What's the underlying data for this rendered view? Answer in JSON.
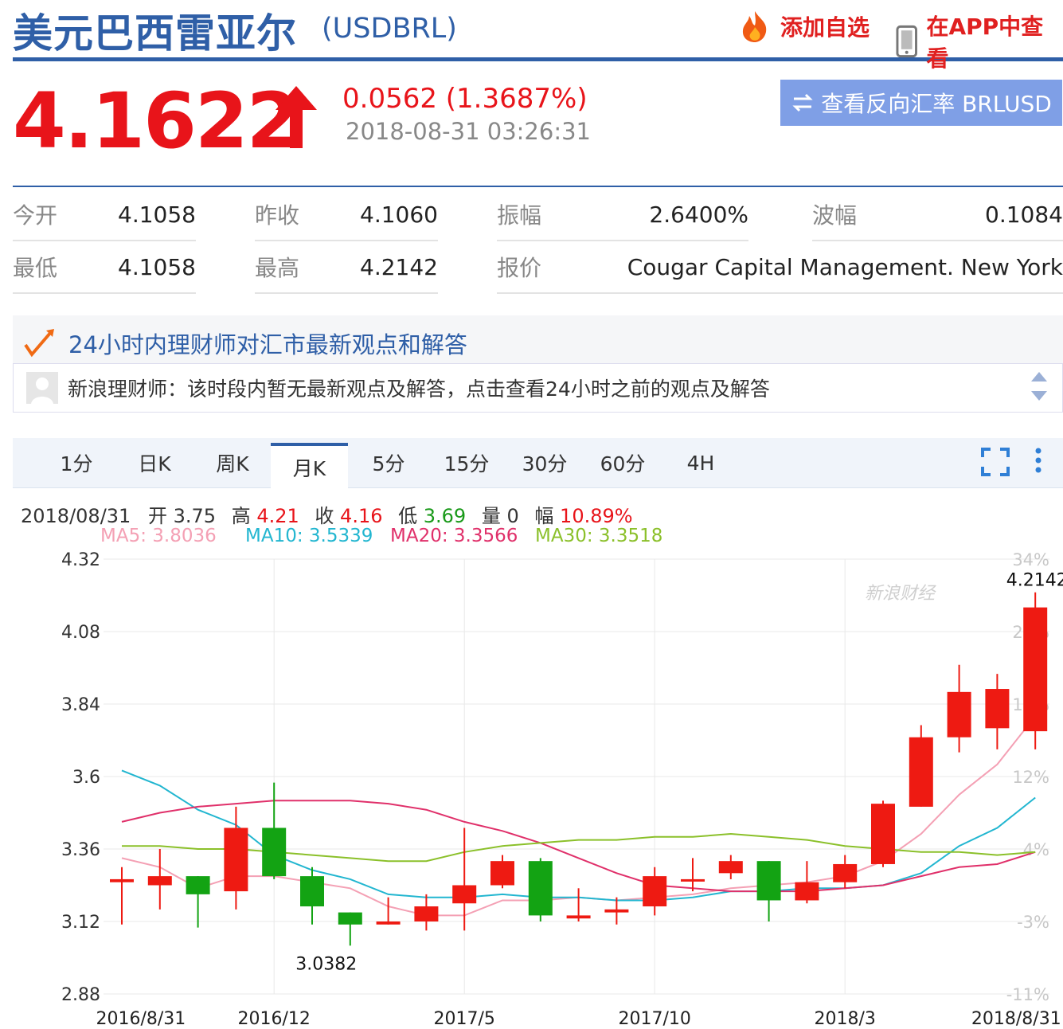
{
  "header": {
    "title": "美元巴西雷亚尔",
    "code": "(USDBRL)",
    "add_favorite": "添加自选",
    "view_in_app": "在APP中查看"
  },
  "quote": {
    "price": "4.1622",
    "change": "0.0562 (1.3687%)",
    "datetime": "2018-08-31 03:26:31",
    "reverse_button": "查看反向汇率 BRLUSD",
    "colors": {
      "up": "#e8141a",
      "accent": "#2f5fa7"
    }
  },
  "stats": [
    {
      "label": "今开",
      "value": "4.1058"
    },
    {
      "label": "昨收",
      "value": "4.1060"
    },
    {
      "label": "振幅",
      "value": "2.6400%"
    },
    {
      "label": "波幅",
      "value": "0.1084"
    },
    {
      "label": "最低",
      "value": "4.1058"
    },
    {
      "label": "最高",
      "value": "4.2142"
    },
    {
      "label": "报价",
      "value": "Cougar Capital Management. New York"
    }
  ],
  "advisor": {
    "heading": "24小时内理财师对汇市最新观点和解答",
    "message": "新浪理财师：该时段内暂无最新观点及解答，点击查看24小时之前的观点及解答"
  },
  "tabs": [
    "1分",
    "日K",
    "周K",
    "月K",
    "5分",
    "15分",
    "30分",
    "60分",
    "4H"
  ],
  "active_tab": "月K",
  "ohlc": {
    "date": "2018/08/31",
    "open_label": "开",
    "open": "3.75",
    "high_label": "高",
    "high": "4.21",
    "close_label": "收",
    "close": "4.16",
    "low_label": "低",
    "low": "3.69",
    "volume_label": "量",
    "volume": "0",
    "range_label": "幅",
    "range": "10.89%"
  },
  "ma_legend": [
    {
      "text": "MA5: 3.8036",
      "color": "#f4a0b4"
    },
    {
      "text": "MA10: 3.5339",
      "color": "#22b6d0"
    },
    {
      "text": "MA20: 3.3566",
      "color": "#e0306a"
    },
    {
      "text": "MA30: 3.3518",
      "color": "#8bc02a"
    }
  ],
  "watermark": "新浪财经",
  "chart_data": {
    "type": "candlestick",
    "ylim": [
      2.88,
      4.32
    ],
    "yticks": [
      "4.32",
      "4.08",
      "3.84",
      "3.6",
      "3.36",
      "3.12",
      "2.88"
    ],
    "right_ticks": [
      "34%",
      "27%",
      "19%",
      "12%",
      "4%",
      "-3%",
      "-11%"
    ],
    "xtick_labels": [
      "2016/8/31",
      "2016/12",
      "2017/5",
      "2017/10",
      "2018/3",
      "2018/8/31"
    ],
    "xtick_index": [
      0.5,
      4,
      9,
      14,
      19,
      23.5
    ],
    "annotations": [
      {
        "text": "4.2142",
        "index": 24
      },
      {
        "text": "3.0382",
        "index": 6
      }
    ],
    "candles": [
      {
        "o": 3.25,
        "h": 3.3,
        "l": 3.11,
        "c": 3.26
      },
      {
        "o": 3.24,
        "h": 3.36,
        "l": 3.16,
        "c": 3.27
      },
      {
        "o": 3.27,
        "h": 3.27,
        "l": 3.1,
        "c": 3.21
      },
      {
        "o": 3.22,
        "h": 3.5,
        "l": 3.16,
        "c": 3.43
      },
      {
        "o": 3.43,
        "h": 3.58,
        "l": 3.26,
        "c": 3.27
      },
      {
        "o": 3.27,
        "h": 3.3,
        "l": 3.11,
        "c": 3.17
      },
      {
        "o": 3.15,
        "h": 3.15,
        "l": 3.04,
        "c": 3.11
      },
      {
        "o": 3.11,
        "h": 3.2,
        "l": 3.11,
        "c": 3.12
      },
      {
        "o": 3.12,
        "h": 3.21,
        "l": 3.09,
        "c": 3.17
      },
      {
        "o": 3.18,
        "h": 3.43,
        "l": 3.09,
        "c": 3.24
      },
      {
        "o": 3.24,
        "h": 3.34,
        "l": 3.23,
        "c": 3.32
      },
      {
        "o": 3.32,
        "h": 3.33,
        "l": 3.12,
        "c": 3.14
      },
      {
        "o": 3.13,
        "h": 3.23,
        "l": 3.12,
        "c": 3.14
      },
      {
        "o": 3.15,
        "h": 3.2,
        "l": 3.11,
        "c": 3.16
      },
      {
        "o": 3.17,
        "h": 3.3,
        "l": 3.14,
        "c": 3.27
      },
      {
        "o": 3.26,
        "h": 3.33,
        "l": 3.22,
        "c": 3.26
      },
      {
        "o": 3.28,
        "h": 3.34,
        "l": 3.26,
        "c": 3.32
      },
      {
        "o": 3.32,
        "h": 3.32,
        "l": 3.12,
        "c": 3.19
      },
      {
        "o": 3.19,
        "h": 3.32,
        "l": 3.18,
        "c": 3.25
      },
      {
        "o": 3.25,
        "h": 3.34,
        "l": 3.23,
        "c": 3.31
      },
      {
        "o": 3.31,
        "h": 3.52,
        "l": 3.3,
        "c": 3.51
      },
      {
        "o": 3.5,
        "h": 3.77,
        "l": 3.5,
        "c": 3.73
      },
      {
        "o": 3.73,
        "h": 3.97,
        "l": 3.68,
        "c": 3.88
      },
      {
        "o": 3.76,
        "h": 3.94,
        "l": 3.69,
        "c": 3.89
      },
      {
        "o": 3.75,
        "h": 4.21,
        "l": 3.69,
        "c": 4.16
      }
    ],
    "series": [
      {
        "name": "MA5",
        "color": "#f4a0b4",
        "values": [
          3.33,
          3.3,
          3.23,
          3.27,
          3.27,
          3.25,
          3.23,
          3.17,
          3.14,
          3.14,
          3.19,
          3.19,
          3.2,
          3.19,
          3.2,
          3.21,
          3.23,
          3.24,
          3.25,
          3.27,
          3.32,
          3.41,
          3.54,
          3.64,
          3.8
        ]
      },
      {
        "name": "MA10",
        "color": "#22b6d0",
        "values": [
          3.62,
          3.57,
          3.49,
          3.44,
          3.34,
          3.29,
          3.26,
          3.21,
          3.2,
          3.2,
          3.21,
          3.2,
          3.2,
          3.19,
          3.19,
          3.2,
          3.22,
          3.22,
          3.23,
          3.23,
          3.24,
          3.28,
          3.37,
          3.43,
          3.53
        ]
      },
      {
        "name": "MA20",
        "color": "#e0306a",
        "values": [
          3.45,
          3.48,
          3.5,
          3.51,
          3.52,
          3.52,
          3.52,
          3.51,
          3.49,
          3.45,
          3.42,
          3.38,
          3.33,
          3.28,
          3.24,
          3.23,
          3.22,
          3.22,
          3.22,
          3.23,
          3.24,
          3.27,
          3.3,
          3.31,
          3.35
        ]
      },
      {
        "name": "MA30",
        "color": "#8bc02a",
        "values": [
          3.37,
          3.37,
          3.36,
          3.36,
          3.35,
          3.34,
          3.33,
          3.32,
          3.32,
          3.35,
          3.37,
          3.38,
          3.39,
          3.39,
          3.4,
          3.4,
          3.41,
          3.4,
          3.39,
          3.37,
          3.36,
          3.35,
          3.35,
          3.34,
          3.35
        ]
      }
    ]
  }
}
